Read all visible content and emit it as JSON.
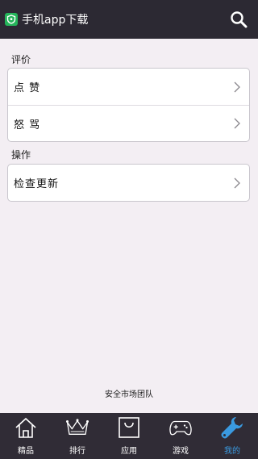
{
  "header": {
    "title": "手机app下载",
    "logo_icon": "shield-icon",
    "search_icon": "search-icon"
  },
  "sections": [
    {
      "label": "评价",
      "items": [
        {
          "label": "点 赞",
          "icon": "chevron-right-icon"
        },
        {
          "label": "怒 骂",
          "icon": "chevron-right-icon"
        }
      ]
    },
    {
      "label": "操作",
      "items": [
        {
          "label": "检查更新",
          "icon": "chevron-right-icon"
        }
      ]
    }
  ],
  "footer": {
    "team": "安全市场团队"
  },
  "tabbar": {
    "tabs": [
      {
        "label": "精品",
        "icon": "house-icon",
        "active": false
      },
      {
        "label": "排行",
        "icon": "crown-icon",
        "active": false
      },
      {
        "label": "应用",
        "icon": "shopping-bag-icon",
        "active": false
      },
      {
        "label": "游戏",
        "icon": "gamepad-icon",
        "active": false
      },
      {
        "label": "我的",
        "icon": "wrench-icon",
        "active": true
      }
    ],
    "active_color": "#3a9ae0"
  },
  "colors": {
    "header_bg": "#2c2933",
    "page_bg": "#f3eef3",
    "logo_green": "#25b45a",
    "tabbar_bg": "#302c36"
  }
}
